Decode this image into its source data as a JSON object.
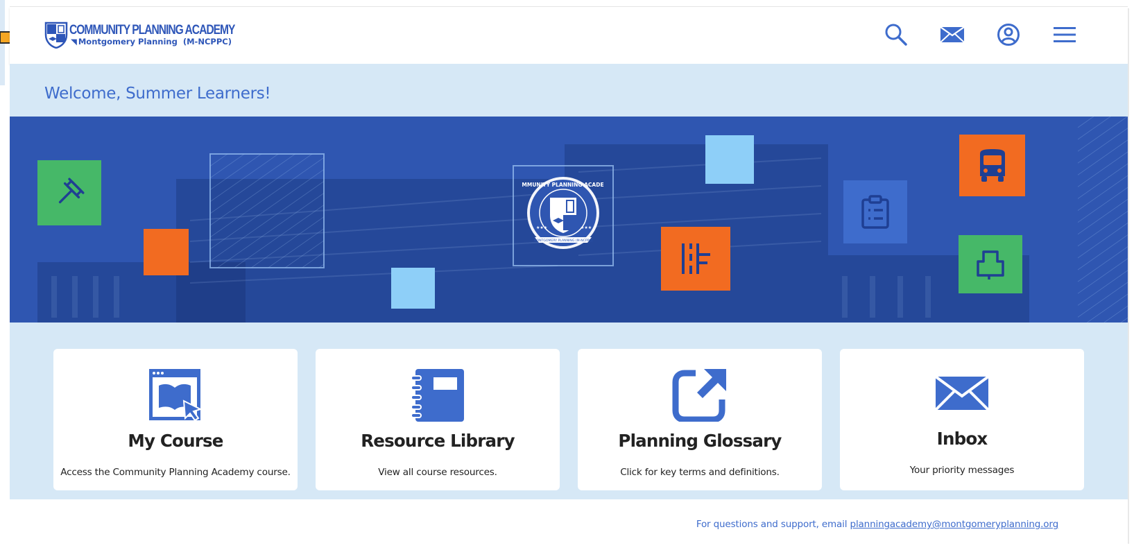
{
  "header": {
    "logo_title": "COMMUNITY PLANNING ACADEMY",
    "logo_subtitle": "Montgomery Planning",
    "logo_org": "(M-NCPPC)",
    "icons": [
      "search-icon",
      "mail-icon",
      "user-account-icon",
      "hamburger-menu-icon"
    ]
  },
  "welcome": {
    "title": "Welcome, Summer Learners!"
  },
  "hero": {
    "seal_text": "COMMUNITY PLANNING ACADEMY",
    "seal_banner": "MONTGOMERY PLANNING (M-NCPPC)",
    "icons": [
      "gavel-icon",
      "bus-icon",
      "clipboard-list-icon",
      "floor-plan-icon",
      "building-icon",
      "seal-emblem"
    ]
  },
  "cards": [
    {
      "title": "My Course",
      "desc": "Access the Community Planning Academy course.",
      "icon": "book-pointer-icon"
    },
    {
      "title": "Resource Library",
      "desc": "View all course resources.",
      "icon": "notebook-icon"
    },
    {
      "title": "Planning Glossary",
      "desc": "Click for key terms and definitions.",
      "icon": "external-link-icon"
    },
    {
      "title": "Inbox",
      "desc": "Your priority messages",
      "icon": "envelope-icon"
    }
  ],
  "footer": {
    "text": "For questions and support, email ",
    "email": "planningacademy@montgomeryplanning.org"
  },
  "colors": {
    "brand_blue": "#3e6ccc",
    "hero_blue": "#2f56b1",
    "band_light_blue": "#d6e8f6",
    "tile_green": "#46b868",
    "tile_orange": "#f26b21",
    "tile_sky": "#8ecff8",
    "pointer_orange": "#f5a623"
  }
}
